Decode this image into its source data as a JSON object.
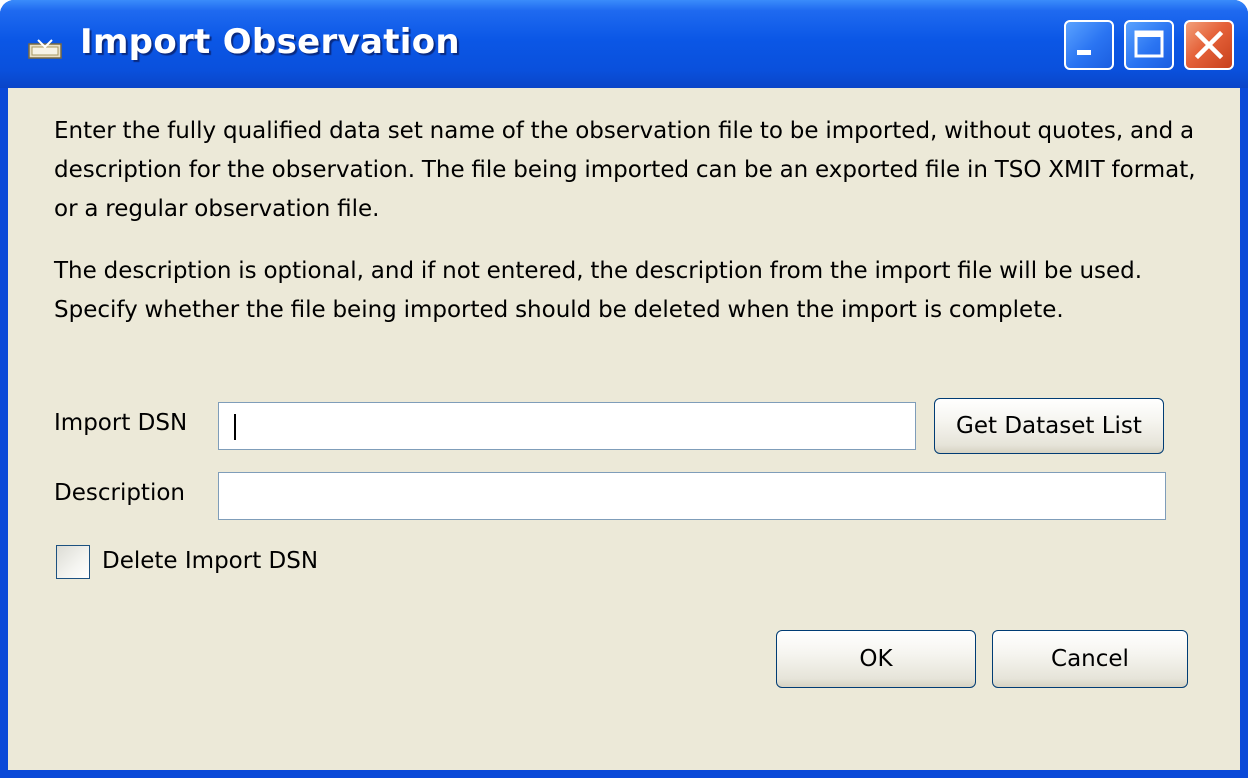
{
  "window": {
    "title": "Import Observation"
  },
  "instructions": {
    "paragraph1": "Enter the fully qualified data set name of the observation file to be imported, without quotes, and a description for the observation.  The file being imported can be an exported file in TSO XMIT format, or a regular observation file.",
    "paragraph2": "The description is optional, and if not entered, the description from the import file will be used.   Specify whether the file being imported should be deleted when the import is complete."
  },
  "form": {
    "import_dsn_label": "Import DSN",
    "import_dsn_value": "",
    "get_dataset_list_label": "Get Dataset List",
    "description_label": "Description",
    "description_value": "",
    "delete_checkbox_label": "Delete Import DSN",
    "delete_checked": false
  },
  "actions": {
    "ok_label": "OK",
    "cancel_label": "Cancel"
  },
  "icons": {
    "title_icon": "import-icon",
    "minimize": "minimize-icon",
    "maximize": "maximize-icon",
    "close": "close-icon"
  },
  "colors": {
    "titlebar": "#0a50dc",
    "dialog_background": "#ece9d8",
    "close_button": "#e5623a"
  }
}
